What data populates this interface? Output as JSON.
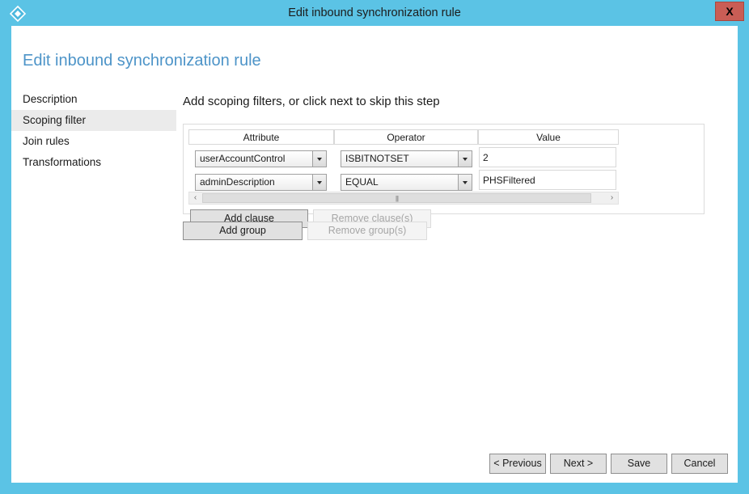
{
  "window": {
    "title": "Edit inbound synchronization rule",
    "icon": "azure-diamond-icon",
    "close_label": "X",
    "titlebar_color": "#5bc3e5",
    "close_button_color": "#c95d55"
  },
  "page": {
    "heading": "Edit inbound synchronization rule",
    "heading_color": "#4d94c8"
  },
  "sidebar": {
    "items": [
      {
        "label": "Description",
        "selected": false
      },
      {
        "label": "Scoping filter",
        "selected": true
      },
      {
        "label": "Join rules",
        "selected": false
      },
      {
        "label": "Transformations",
        "selected": false
      }
    ],
    "selected_highlight_color": "#ebebeb"
  },
  "main": {
    "instruction": "Add scoping filters, or click next to skip this step",
    "table": {
      "columns": [
        "Attribute",
        "Operator",
        "Value"
      ],
      "rows": [
        {
          "attribute": "userAccountControl",
          "operator": "ISBITNOTSET",
          "value": "2"
        },
        {
          "attribute": "adminDescription",
          "operator": "EQUAL",
          "value": "PHSFiltered"
        }
      ]
    },
    "scrollbar": {
      "left_arrow": "‹",
      "right_arrow": "›",
      "grip": "|||"
    },
    "clause_buttons": [
      {
        "label": "Add clause",
        "enabled": true
      },
      {
        "label": "Remove clause(s)",
        "enabled": false
      }
    ],
    "group_buttons": [
      {
        "label": "Add group",
        "enabled": true
      },
      {
        "label": "Remove group(s)",
        "enabled": false
      }
    ]
  },
  "footer": {
    "buttons": [
      {
        "label": "< Previous"
      },
      {
        "label": "Next >"
      },
      {
        "label": "Save"
      },
      {
        "label": "Cancel"
      }
    ]
  }
}
